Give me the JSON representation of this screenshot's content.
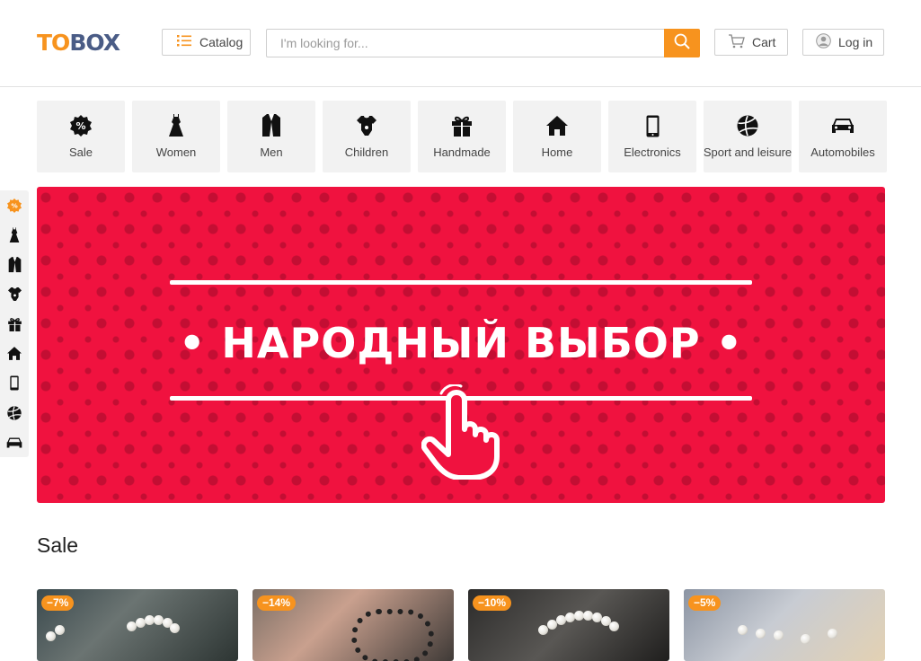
{
  "header": {
    "logo_part1": "TO",
    "logo_part2": "BOX",
    "catalog_label": "Catalog",
    "search_placeholder": "I'm looking for...",
    "cart_label": "Cart",
    "login_label": "Log in"
  },
  "categories": [
    {
      "label": "Sale",
      "icon": "sale-icon"
    },
    {
      "label": "Women",
      "icon": "dress-icon"
    },
    {
      "label": "Men",
      "icon": "suit-icon"
    },
    {
      "label": "Children",
      "icon": "baby-bodysuit-icon"
    },
    {
      "label": "Handmade",
      "icon": "gift-icon"
    },
    {
      "label": "Home",
      "icon": "house-icon"
    },
    {
      "label": "Electronics",
      "icon": "phone-icon"
    },
    {
      "label": "Sport and leisure",
      "icon": "volleyball-icon"
    },
    {
      "label": "Automobiles",
      "icon": "car-icon"
    }
  ],
  "banner": {
    "title": "• НАРОДНЫЙ ВЫБОР •",
    "background_color": "#f0123f"
  },
  "sale_section": {
    "title": "Sale",
    "products": [
      {
        "discount": "−7%"
      },
      {
        "discount": "−14%"
      },
      {
        "discount": "−10%"
      },
      {
        "discount": "−5%"
      }
    ]
  },
  "colors": {
    "accent": "#f7931e",
    "logo_blue": "#4a5c86"
  }
}
